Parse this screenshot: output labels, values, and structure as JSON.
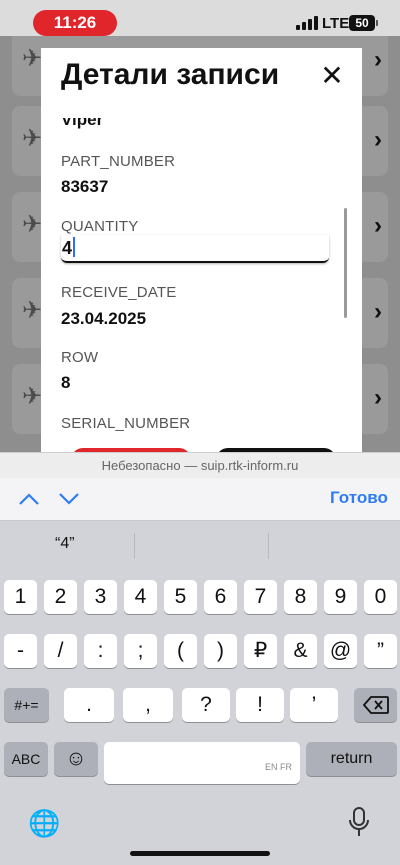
{
  "status": {
    "time": "11:26",
    "network": "LTE",
    "battery": "50"
  },
  "modal": {
    "title": "Детали записи",
    "partial_top_value": "Viper",
    "fields": [
      {
        "label": "PART_NUMBER",
        "value": "83637"
      },
      {
        "label": "QUANTITY",
        "value": "4"
      },
      {
        "label": "RECEIVE_DATE",
        "value": "23.04.2025"
      },
      {
        "label": "ROW",
        "value": "8"
      },
      {
        "label": "SERIAL_NUMBER",
        "value": ""
      }
    ]
  },
  "browser": {
    "url_text": "Небезопасно — suip.rtk-inform.ru"
  },
  "accessory": {
    "done_label": "Готово"
  },
  "keyboard": {
    "suggestion": "“4”",
    "row1": [
      "1",
      "2",
      "3",
      "4",
      "5",
      "6",
      "7",
      "8",
      "9",
      "0"
    ],
    "row2": [
      "-",
      "/",
      ":",
      ";",
      "(",
      ")",
      "₽",
      "&",
      "@",
      "”"
    ],
    "row3_left": "#+=",
    "row3": [
      ".",
      ",",
      "?",
      "!",
      "’"
    ],
    "abc": "ABC",
    "space_hint": "EN FR",
    "return": "return"
  }
}
